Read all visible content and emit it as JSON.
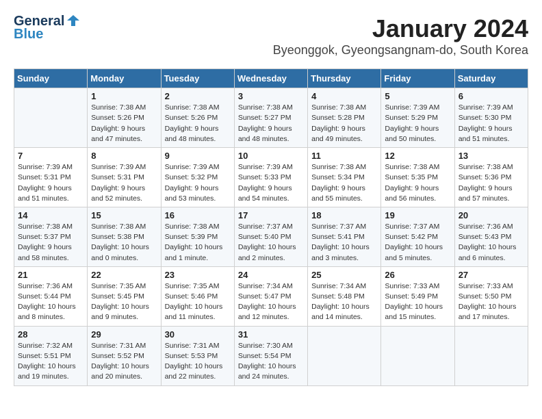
{
  "header": {
    "logo_line1": "General",
    "logo_line2": "Blue",
    "month": "January 2024",
    "location": "Byeonggok, Gyeongsangnam-do, South Korea"
  },
  "days_of_week": [
    "Sunday",
    "Monday",
    "Tuesday",
    "Wednesday",
    "Thursday",
    "Friday",
    "Saturday"
  ],
  "weeks": [
    [
      {
        "day": "",
        "info": ""
      },
      {
        "day": "1",
        "info": "Sunrise: 7:38 AM\nSunset: 5:26 PM\nDaylight: 9 hours\nand 47 minutes."
      },
      {
        "day": "2",
        "info": "Sunrise: 7:38 AM\nSunset: 5:26 PM\nDaylight: 9 hours\nand 48 minutes."
      },
      {
        "day": "3",
        "info": "Sunrise: 7:38 AM\nSunset: 5:27 PM\nDaylight: 9 hours\nand 48 minutes."
      },
      {
        "day": "4",
        "info": "Sunrise: 7:38 AM\nSunset: 5:28 PM\nDaylight: 9 hours\nand 49 minutes."
      },
      {
        "day": "5",
        "info": "Sunrise: 7:39 AM\nSunset: 5:29 PM\nDaylight: 9 hours\nand 50 minutes."
      },
      {
        "day": "6",
        "info": "Sunrise: 7:39 AM\nSunset: 5:30 PM\nDaylight: 9 hours\nand 51 minutes."
      }
    ],
    [
      {
        "day": "7",
        "info": "Sunrise: 7:39 AM\nSunset: 5:31 PM\nDaylight: 9 hours\nand 51 minutes."
      },
      {
        "day": "8",
        "info": "Sunrise: 7:39 AM\nSunset: 5:31 PM\nDaylight: 9 hours\nand 52 minutes."
      },
      {
        "day": "9",
        "info": "Sunrise: 7:39 AM\nSunset: 5:32 PM\nDaylight: 9 hours\nand 53 minutes."
      },
      {
        "day": "10",
        "info": "Sunrise: 7:39 AM\nSunset: 5:33 PM\nDaylight: 9 hours\nand 54 minutes."
      },
      {
        "day": "11",
        "info": "Sunrise: 7:38 AM\nSunset: 5:34 PM\nDaylight: 9 hours\nand 55 minutes."
      },
      {
        "day": "12",
        "info": "Sunrise: 7:38 AM\nSunset: 5:35 PM\nDaylight: 9 hours\nand 56 minutes."
      },
      {
        "day": "13",
        "info": "Sunrise: 7:38 AM\nSunset: 5:36 PM\nDaylight: 9 hours\nand 57 minutes."
      }
    ],
    [
      {
        "day": "14",
        "info": "Sunrise: 7:38 AM\nSunset: 5:37 PM\nDaylight: 9 hours\nand 58 minutes."
      },
      {
        "day": "15",
        "info": "Sunrise: 7:38 AM\nSunset: 5:38 PM\nDaylight: 10 hours\nand 0 minutes."
      },
      {
        "day": "16",
        "info": "Sunrise: 7:38 AM\nSunset: 5:39 PM\nDaylight: 10 hours\nand 1 minute."
      },
      {
        "day": "17",
        "info": "Sunrise: 7:37 AM\nSunset: 5:40 PM\nDaylight: 10 hours\nand 2 minutes."
      },
      {
        "day": "18",
        "info": "Sunrise: 7:37 AM\nSunset: 5:41 PM\nDaylight: 10 hours\nand 3 minutes."
      },
      {
        "day": "19",
        "info": "Sunrise: 7:37 AM\nSunset: 5:42 PM\nDaylight: 10 hours\nand 5 minutes."
      },
      {
        "day": "20",
        "info": "Sunrise: 7:36 AM\nSunset: 5:43 PM\nDaylight: 10 hours\nand 6 minutes."
      }
    ],
    [
      {
        "day": "21",
        "info": "Sunrise: 7:36 AM\nSunset: 5:44 PM\nDaylight: 10 hours\nand 8 minutes."
      },
      {
        "day": "22",
        "info": "Sunrise: 7:35 AM\nSunset: 5:45 PM\nDaylight: 10 hours\nand 9 minutes."
      },
      {
        "day": "23",
        "info": "Sunrise: 7:35 AM\nSunset: 5:46 PM\nDaylight: 10 hours\nand 11 minutes."
      },
      {
        "day": "24",
        "info": "Sunrise: 7:34 AM\nSunset: 5:47 PM\nDaylight: 10 hours\nand 12 minutes."
      },
      {
        "day": "25",
        "info": "Sunrise: 7:34 AM\nSunset: 5:48 PM\nDaylight: 10 hours\nand 14 minutes."
      },
      {
        "day": "26",
        "info": "Sunrise: 7:33 AM\nSunset: 5:49 PM\nDaylight: 10 hours\nand 15 minutes."
      },
      {
        "day": "27",
        "info": "Sunrise: 7:33 AM\nSunset: 5:50 PM\nDaylight: 10 hours\nand 17 minutes."
      }
    ],
    [
      {
        "day": "28",
        "info": "Sunrise: 7:32 AM\nSunset: 5:51 PM\nDaylight: 10 hours\nand 19 minutes."
      },
      {
        "day": "29",
        "info": "Sunrise: 7:31 AM\nSunset: 5:52 PM\nDaylight: 10 hours\nand 20 minutes."
      },
      {
        "day": "30",
        "info": "Sunrise: 7:31 AM\nSunset: 5:53 PM\nDaylight: 10 hours\nand 22 minutes."
      },
      {
        "day": "31",
        "info": "Sunrise: 7:30 AM\nSunset: 5:54 PM\nDaylight: 10 hours\nand 24 minutes."
      },
      {
        "day": "",
        "info": ""
      },
      {
        "day": "",
        "info": ""
      },
      {
        "day": "",
        "info": ""
      }
    ]
  ]
}
